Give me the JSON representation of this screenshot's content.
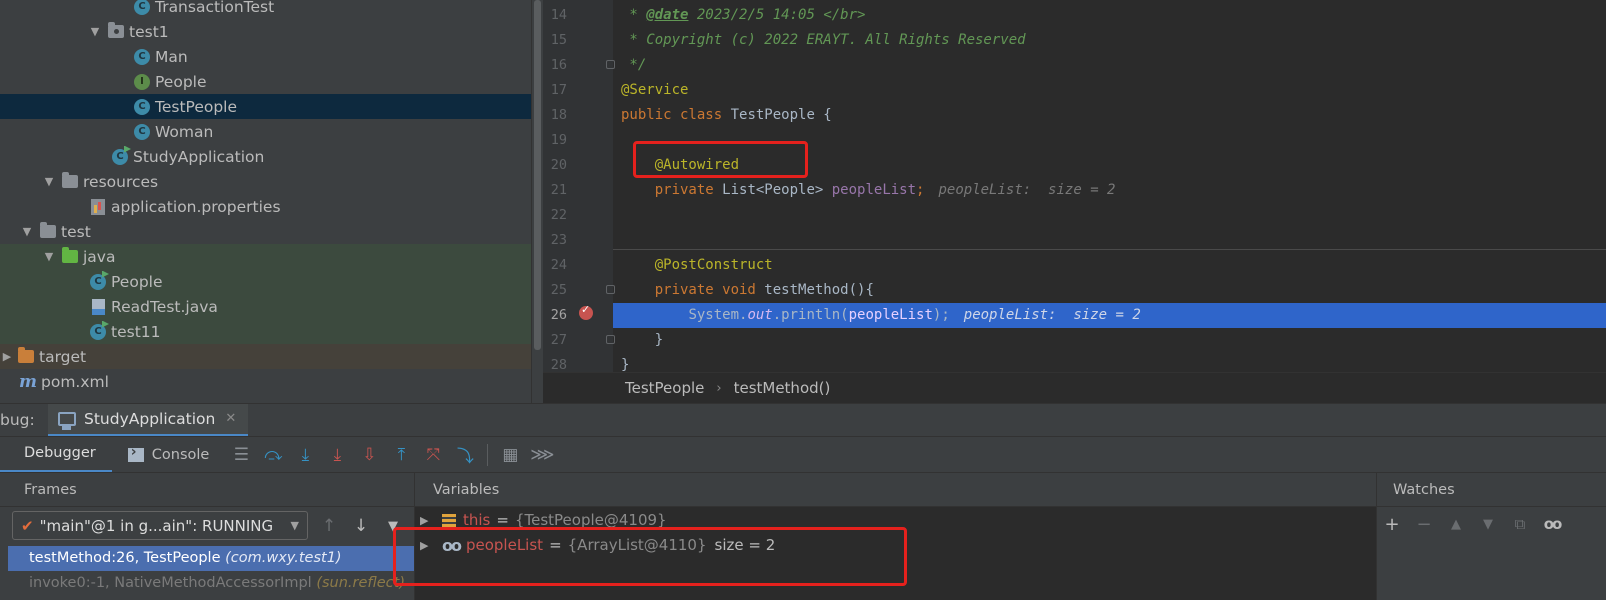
{
  "project_tree": {
    "items": [
      {
        "label": "TransactionTest",
        "icon": "class-icon",
        "kind": "class"
      },
      {
        "label": "test1",
        "icon": "package-folder-icon",
        "kind": "package"
      },
      {
        "label": "Man",
        "icon": "class-icon",
        "kind": "class"
      },
      {
        "label": "People",
        "icon": "interface-icon",
        "kind": "interface"
      },
      {
        "label": "TestPeople",
        "icon": "class-icon",
        "kind": "class"
      },
      {
        "label": "Woman",
        "icon": "class-icon",
        "kind": "class"
      },
      {
        "label": "StudyApplication",
        "icon": "spring-boot-app-icon",
        "kind": "app"
      },
      {
        "label": "resources",
        "icon": "resources-folder-icon",
        "kind": "folder"
      },
      {
        "label": "application.properties",
        "icon": "properties-file-icon",
        "kind": "file"
      },
      {
        "label": "test",
        "icon": "folder-icon",
        "kind": "folder"
      },
      {
        "label": "java",
        "icon": "test-source-folder-icon",
        "kind": "folder"
      },
      {
        "label": "People",
        "icon": "spring-bean-class-icon",
        "kind": "app"
      },
      {
        "label": "ReadTest.java",
        "icon": "java-file-icon",
        "kind": "file"
      },
      {
        "label": "test11",
        "icon": "spring-bean-class-icon",
        "kind": "app"
      },
      {
        "label": "target",
        "icon": "excluded-folder-icon",
        "kind": "folder"
      },
      {
        "label": "pom.xml",
        "icon": "maven-icon",
        "kind": "maven"
      }
    ]
  },
  "editor": {
    "line_numbers": [
      "14",
      "15",
      "16",
      "17",
      "18",
      "19",
      "20",
      "21",
      "22",
      "23",
      "24",
      "25",
      "26",
      "27",
      "28"
    ],
    "line14": {
      "star": " * ",
      "tag": "@date",
      "text": " 2023/2/5 14:05 </br>"
    },
    "line15": " * Copyright (c) 2022 ERAYT. All Rights Reserved",
    "line16": " */",
    "line17": "@Service",
    "line18": {
      "kw": "public class",
      "rest": " TestPeople {"
    },
    "line20": "    @Autowired",
    "line21": {
      "indent": "    ",
      "kw": "private",
      "type": " List<People> ",
      "field": "peopleList",
      "semi": ";",
      "hint": "peopleList:  size = 2"
    },
    "line24": "    @PostConstruct",
    "line25": {
      "indent": "    ",
      "kw": "private void",
      "rest": " testMethod(){"
    },
    "line26": {
      "indent": "        ",
      "obj": "System.",
      "static": "out",
      "call": ".println(",
      "field": "peopleList",
      "end": ");",
      "hint": "peopleList:  size = 2"
    },
    "line27": "    }",
    "line28": "}"
  },
  "breadcrumb": {
    "class_name": "TestPeople",
    "method_name": "testMethod()"
  },
  "debug": {
    "label": "bug:",
    "run_config": "StudyApplication",
    "tabs": {
      "debugger": "Debugger",
      "console": "Console"
    },
    "frames_title": "Frames",
    "thread": "\"main\"@1 in g...ain\": RUNNING",
    "frames": [
      {
        "method": "testMethod:26, TestPeople ",
        "pkg": "(com.wxy.test1)"
      },
      {
        "method": "invoke0:-1, NativeMethodAccessorImpl ",
        "pkg": "(sun.reflect)"
      }
    ],
    "variables_title": "Variables",
    "variables": [
      {
        "name": "this",
        "eq": "=",
        "value": "{TestPeople@4109}",
        "extra": ""
      },
      {
        "name": "peopleList",
        "eq": "=",
        "value": "{ArrayList@4110}",
        "extra": "size = 2"
      }
    ],
    "watches_title": "Watches"
  },
  "colors": {
    "accent": "#4a88c7",
    "selection": "#4b6eaf",
    "current_line": "#2f65ca",
    "highlight_box": "#e5211d"
  }
}
